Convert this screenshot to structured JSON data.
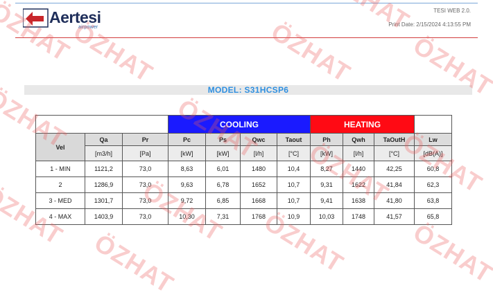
{
  "header": {
    "logo_text": "Aertesi",
    "logo_subtext": "airpower",
    "app_name": "TESI WEB 2.0.",
    "print_date": "Print Date: 2/15/2024 4:13:55 PM"
  },
  "model": {
    "title": "MODEL: S31HCSP6"
  },
  "table": {
    "groups": {
      "cooling": "COOLING",
      "heating": "HEATING"
    },
    "columns": [
      "Vel",
      "Qa",
      "Pr",
      "Pc",
      "Ps",
      "Qwc",
      "Taout",
      "Ph",
      "Qwh",
      "TaOutH",
      "Lw"
    ],
    "units": [
      "",
      "[m3/h]",
      "[Pa]",
      "[kW]",
      "[kW]",
      "[l/h]",
      "[°C]",
      "[kW]",
      "[l/h]",
      "[°C]",
      "[dB(A)]"
    ],
    "rows": [
      [
        "1 - MIN",
        "1121,2",
        "73,0",
        "8,63",
        "6,01",
        "1480",
        "10,4",
        "8,27",
        "1440",
        "42,25",
        "60,8"
      ],
      [
        "2",
        "1286,9",
        "73,0",
        "9,63",
        "6,78",
        "1652",
        "10,7",
        "9,31",
        "1622",
        "41,84",
        "62,3"
      ],
      [
        "3 - MED",
        "1301,7",
        "73,0",
        "9,72",
        "6,85",
        "1668",
        "10,7",
        "9,41",
        "1638",
        "41,80",
        "63,8"
      ],
      [
        "4 - MAX",
        "1403,9",
        "73,0",
        "10,30",
        "7,31",
        "1768",
        "10,9",
        "10,03",
        "1748",
        "41,57",
        "65,8"
      ]
    ]
  },
  "watermark": {
    "text": "ÖZHAT"
  },
  "colors": {
    "cooling": "#1a1aff",
    "heating": "#ff0a14",
    "model_title": "#2e8fe0",
    "watermark": "#eb5a5a"
  }
}
